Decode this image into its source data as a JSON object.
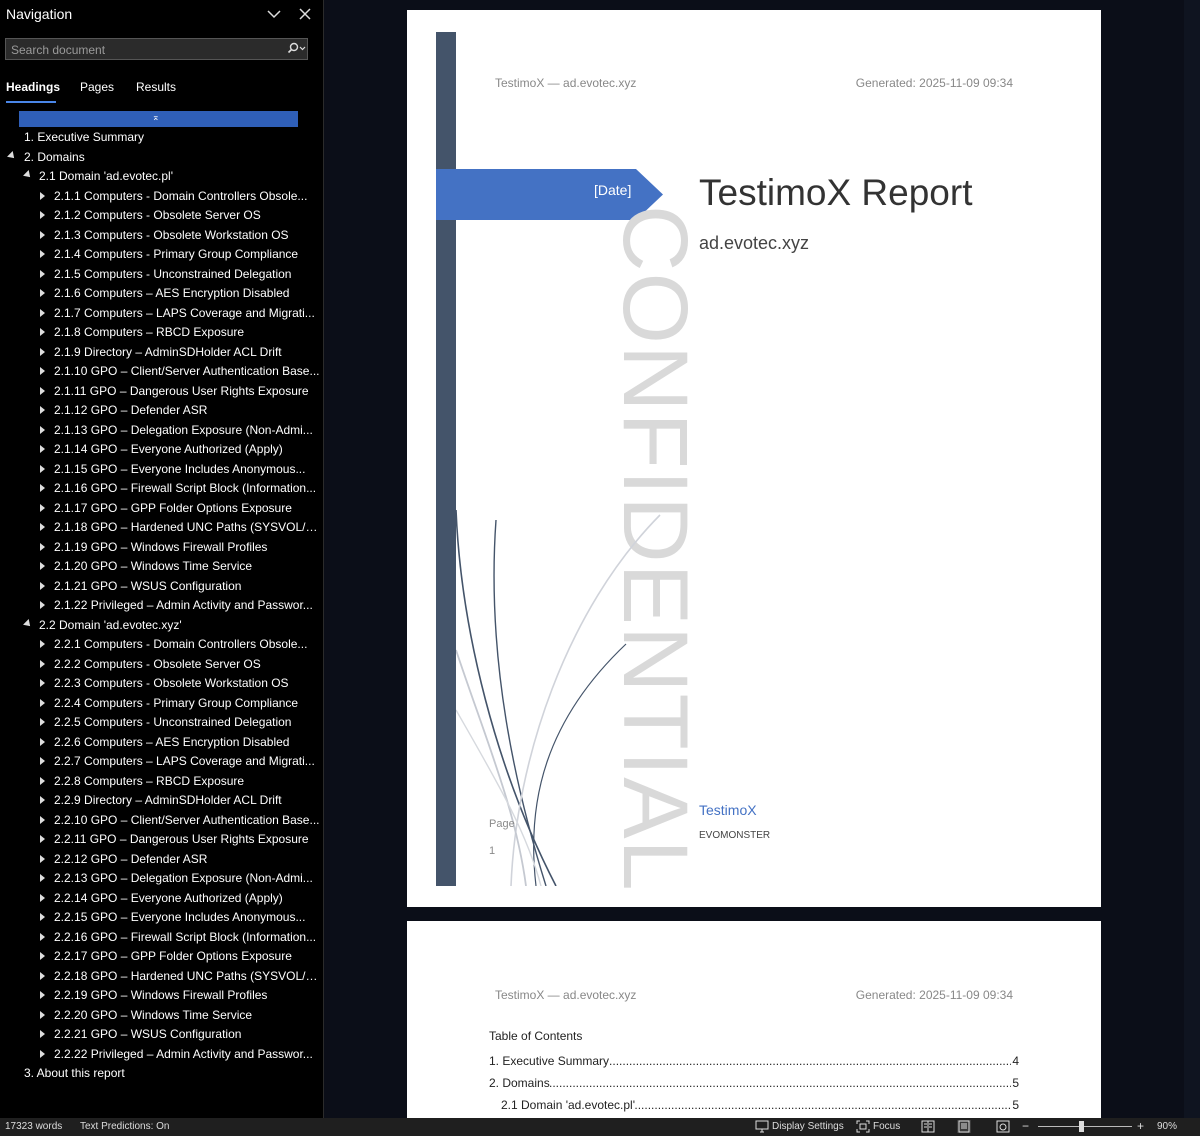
{
  "nav": {
    "title": "Navigation",
    "search_placeholder": "Search document",
    "tabs": [
      "Headings",
      "Pages",
      "Results"
    ],
    "active_tab": "Headings",
    "headings": [
      {
        "label": "1. Executive Summary",
        "level": 0,
        "toggle": "none"
      },
      {
        "label": "2. Domains",
        "level": 0,
        "toggle": "expanded"
      },
      {
        "label": "2.1 Domain 'ad.evotec.pl'",
        "level": 1,
        "toggle": "expanded"
      },
      {
        "label": "2.1.1 Computers - Domain Controllers Obsole...",
        "level": 2,
        "toggle": "collapsed"
      },
      {
        "label": "2.1.2 Computers - Obsolete Server OS",
        "level": 2,
        "toggle": "collapsed"
      },
      {
        "label": "2.1.3 Computers - Obsolete Workstation OS",
        "level": 2,
        "toggle": "collapsed"
      },
      {
        "label": "2.1.4 Computers - Primary Group Compliance",
        "level": 2,
        "toggle": "collapsed"
      },
      {
        "label": "2.1.5 Computers - Unconstrained Delegation",
        "level": 2,
        "toggle": "collapsed"
      },
      {
        "label": "2.1.6 Computers – AES Encryption Disabled",
        "level": 2,
        "toggle": "collapsed"
      },
      {
        "label": "2.1.7 Computers – LAPS Coverage and Migrati...",
        "level": 2,
        "toggle": "collapsed"
      },
      {
        "label": "2.1.8 Computers – RBCD Exposure",
        "level": 2,
        "toggle": "collapsed"
      },
      {
        "label": "2.1.9 Directory – AdminSDHolder ACL Drift",
        "level": 2,
        "toggle": "collapsed"
      },
      {
        "label": "2.1.10 GPO – Client/Server Authentication Base...",
        "level": 2,
        "toggle": "collapsed"
      },
      {
        "label": "2.1.11 GPO – Dangerous User Rights Exposure",
        "level": 2,
        "toggle": "collapsed"
      },
      {
        "label": "2.1.12 GPO – Defender ASR",
        "level": 2,
        "toggle": "collapsed"
      },
      {
        "label": "2.1.13 GPO – Delegation Exposure (Non-Admi...",
        "level": 2,
        "toggle": "collapsed"
      },
      {
        "label": "2.1.14 GPO – Everyone Authorized (Apply)",
        "level": 2,
        "toggle": "collapsed"
      },
      {
        "label": "2.1.15 GPO – Everyone Includes Anonymous...",
        "level": 2,
        "toggle": "collapsed"
      },
      {
        "label": "2.1.16 GPO – Firewall Script Block (Information...",
        "level": 2,
        "toggle": "collapsed"
      },
      {
        "label": "2.1.17 GPO – GPP Folder Options Exposure",
        "level": 2,
        "toggle": "collapsed"
      },
      {
        "label": "2.1.18 GPO – Hardened UNC Paths (SYSVOL/N...",
        "level": 2,
        "toggle": "collapsed"
      },
      {
        "label": "2.1.19 GPO – Windows Firewall Profiles",
        "level": 2,
        "toggle": "collapsed"
      },
      {
        "label": "2.1.20 GPO – Windows Time Service",
        "level": 2,
        "toggle": "collapsed"
      },
      {
        "label": "2.1.21 GPO – WSUS Configuration",
        "level": 2,
        "toggle": "collapsed"
      },
      {
        "label": "2.1.22 Privileged – Admin Activity and Passwor...",
        "level": 2,
        "toggle": "collapsed"
      },
      {
        "label": "2.2 Domain 'ad.evotec.xyz'",
        "level": 1,
        "toggle": "expanded"
      },
      {
        "label": "2.2.1 Computers - Domain Controllers Obsole...",
        "level": 2,
        "toggle": "collapsed"
      },
      {
        "label": "2.2.2 Computers - Obsolete Server OS",
        "level": 2,
        "toggle": "collapsed"
      },
      {
        "label": "2.2.3 Computers - Obsolete Workstation OS",
        "level": 2,
        "toggle": "collapsed"
      },
      {
        "label": "2.2.4 Computers - Primary Group Compliance",
        "level": 2,
        "toggle": "collapsed"
      },
      {
        "label": "2.2.5 Computers - Unconstrained Delegation",
        "level": 2,
        "toggle": "collapsed"
      },
      {
        "label": "2.2.6 Computers – AES Encryption Disabled",
        "level": 2,
        "toggle": "collapsed"
      },
      {
        "label": "2.2.7 Computers – LAPS Coverage and Migrati...",
        "level": 2,
        "toggle": "collapsed"
      },
      {
        "label": "2.2.8 Computers – RBCD Exposure",
        "level": 2,
        "toggle": "collapsed"
      },
      {
        "label": "2.2.9 Directory – AdminSDHolder ACL Drift",
        "level": 2,
        "toggle": "collapsed"
      },
      {
        "label": "2.2.10 GPO – Client/Server Authentication Base...",
        "level": 2,
        "toggle": "collapsed"
      },
      {
        "label": "2.2.11 GPO – Dangerous User Rights Exposure",
        "level": 2,
        "toggle": "collapsed"
      },
      {
        "label": "2.2.12 GPO – Defender ASR",
        "level": 2,
        "toggle": "collapsed"
      },
      {
        "label": "2.2.13 GPO – Delegation Exposure (Non-Admi...",
        "level": 2,
        "toggle": "collapsed"
      },
      {
        "label": "2.2.14 GPO – Everyone Authorized (Apply)",
        "level": 2,
        "toggle": "collapsed"
      },
      {
        "label": "2.2.15 GPO – Everyone Includes Anonymous...",
        "level": 2,
        "toggle": "collapsed"
      },
      {
        "label": "2.2.16 GPO – Firewall Script Block (Information...",
        "level": 2,
        "toggle": "collapsed"
      },
      {
        "label": "2.2.17 GPO – GPP Folder Options Exposure",
        "level": 2,
        "toggle": "collapsed"
      },
      {
        "label": "2.2.18 GPO – Hardened UNC Paths (SYSVOL/N...",
        "level": 2,
        "toggle": "collapsed"
      },
      {
        "label": "2.2.19 GPO – Windows Firewall Profiles",
        "level": 2,
        "toggle": "collapsed"
      },
      {
        "label": "2.2.20 GPO – Windows Time Service",
        "level": 2,
        "toggle": "collapsed"
      },
      {
        "label": "2.2.21 GPO – WSUS Configuration",
        "level": 2,
        "toggle": "collapsed"
      },
      {
        "label": "2.2.22 Privileged – Admin Activity and Passwor...",
        "level": 2,
        "toggle": "collapsed"
      },
      {
        "label": "3. About this report",
        "level": 0,
        "toggle": "none"
      }
    ]
  },
  "document": {
    "header_left": "TestimoX — ad.evotec.xyz",
    "header_right": "Generated: 2025-11-09 09:34",
    "cover": {
      "date_placeholder": "[Date]",
      "title": "TestimoX Report",
      "subtitle": "ad.evotec.xyz",
      "watermark": "CONFIDENTIAL",
      "page_label": "Page",
      "page_number": "1",
      "company": "TestimoX",
      "author": "EVOMONSTER"
    },
    "toc": {
      "title": "Table of Contents",
      "entries": [
        {
          "label": "1. Executive Summary",
          "page": "4",
          "indent": 0
        },
        {
          "label": "2. Domains",
          "page": "5",
          "indent": 0
        },
        {
          "label": "2.1 Domain 'ad.evotec.pl'",
          "page": "5",
          "indent": 1
        }
      ]
    }
  },
  "status": {
    "words": "17323 words",
    "text_predictions": "Text Predictions: On",
    "display_settings": "Display Settings",
    "focus": "Focus",
    "zoom": "90%"
  },
  "colors": {
    "accent_blue": "#4472c4",
    "sidebar_bar": "#44546a",
    "nav_highlight": "#2f5fb8"
  }
}
